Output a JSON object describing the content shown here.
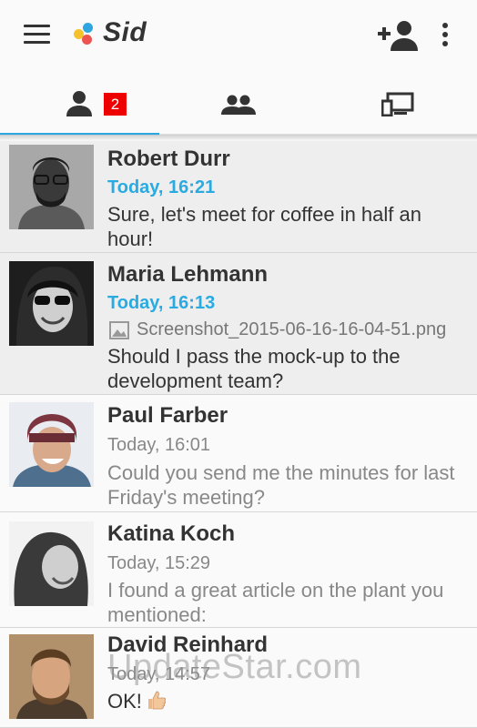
{
  "app": {
    "logo_text": "Sid"
  },
  "toolbar": {
    "menu_icon": "hamburger-menu-icon",
    "add_contact_icon": "add-person-icon",
    "overflow_icon": "more-vert-icon"
  },
  "tabs": [
    {
      "icon": "person-icon",
      "badge": "2",
      "selected": true
    },
    {
      "icon": "group-icon",
      "selected": false
    },
    {
      "icon": "devices-icon",
      "selected": false
    }
  ],
  "colors": {
    "accent": "#29abe2",
    "badge": "#ee0000",
    "unread_bg": "#eeeeee"
  },
  "conversations": [
    {
      "name": "Robert Durr",
      "time": "Today, 16:21",
      "message": "Sure, let's meet for coffee in half an hour!",
      "unread": true
    },
    {
      "name": "Maria Lehmann",
      "time": "Today, 16:13",
      "attachment": "Screenshot_2015-06-16-16-04-51.png",
      "message": "Should I pass the mock-up to the development team?",
      "unread": true
    },
    {
      "name": "Paul Farber",
      "time": "Today, 16:01",
      "message": "Could you send me the minutes for last Friday's meeting?",
      "unread": false
    },
    {
      "name": "Katina Koch",
      "time": "Today, 15:29",
      "message": "I found a great article on the plant you mentioned:",
      "unread": false
    },
    {
      "name": "David Reinhard",
      "time": "Today, 14:57",
      "message": "OK!",
      "message_emoji": "thumbs-up-icon",
      "unread": false
    }
  ],
  "watermark": "UpdateStar.com"
}
